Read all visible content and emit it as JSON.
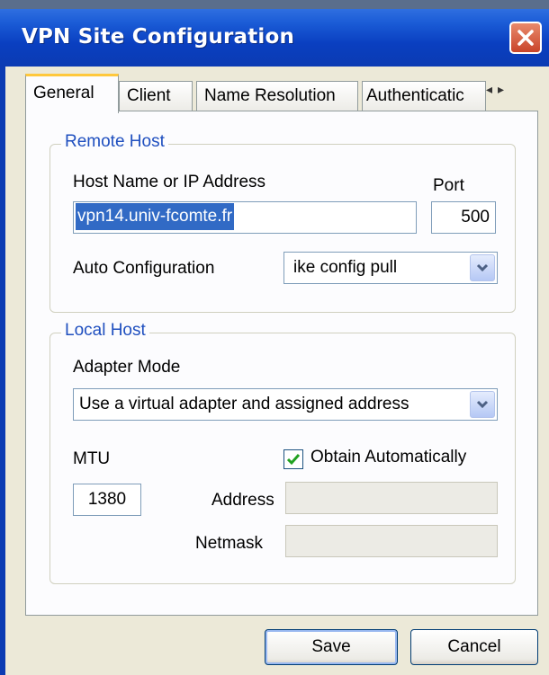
{
  "window": {
    "title": "VPN Site Configuration"
  },
  "tabs": [
    {
      "label": "General",
      "active": true
    },
    {
      "label": "Client",
      "active": false
    },
    {
      "label": "Name Resolution",
      "active": false
    },
    {
      "label": "Authenticatic",
      "active": false
    }
  ],
  "tab_scroll": {
    "left": "◂",
    "right": "▸"
  },
  "remote_host": {
    "group_title": "Remote Host",
    "host_label": "Host Name or IP Address",
    "host_value": "vpn14.univ-fcomte.fr",
    "port_label": "Port",
    "port_value": "500",
    "autoconf_label": "Auto Configuration",
    "autoconf_value": "ike config pull"
  },
  "local_host": {
    "group_title": "Local Host",
    "adapter_label": "Adapter Mode",
    "adapter_value": "Use a virtual adapter and assigned address",
    "mtu_label": "MTU",
    "mtu_value": "1380",
    "obtain_label": "Obtain Automatically",
    "obtain_checked": true,
    "address_label": "Address",
    "address_value": "",
    "netmask_label": "Netmask",
    "netmask_value": ""
  },
  "buttons": {
    "save": "Save",
    "cancel": "Cancel"
  },
  "colors": {
    "titlebar": "#0a3fc0",
    "group_title": "#1f4fbf",
    "selection": "#316ac5",
    "checkmark": "#21a121"
  },
  "icons": [
    "close-icon",
    "tab-scroll-left-icon",
    "tab-scroll-right-icon",
    "chevron-down-icon",
    "checkmark-icon"
  ]
}
